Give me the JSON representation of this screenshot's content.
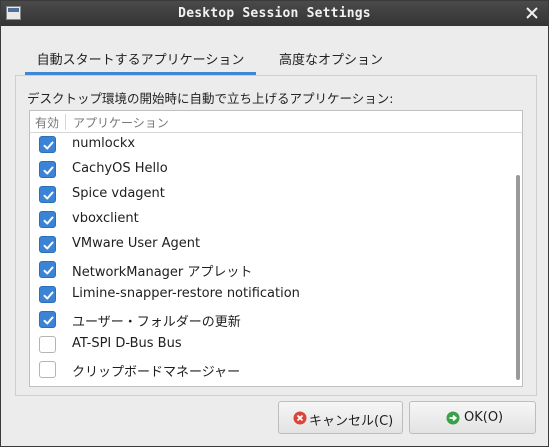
{
  "window": {
    "title": "Desktop Session Settings",
    "icon": "app-window-icon",
    "close_icon": "close-icon"
  },
  "tabs": [
    {
      "label": "自動スタートするアプリケーション",
      "active": true
    },
    {
      "label": "高度なオプション",
      "active": false
    }
  ],
  "description": "デスクトップ環境の開始時に自動で立ち上げるアプリケーション:",
  "list": {
    "columns": {
      "enabled": "有効",
      "application": "アプリケーション"
    },
    "items": [
      {
        "label": "numlockx",
        "checked": true
      },
      {
        "label": "CachyOS Hello",
        "checked": true
      },
      {
        "label": "Spice vdagent",
        "checked": true
      },
      {
        "label": "vboxclient",
        "checked": true
      },
      {
        "label": "VMware User Agent",
        "checked": true
      },
      {
        "label": "NetworkManager アプレット",
        "checked": true
      },
      {
        "label": "Limine-snapper-restore notification",
        "checked": true
      },
      {
        "label": "ユーザー・フォルダーの更新",
        "checked": true
      },
      {
        "label": "AT-SPI D-Bus Bus",
        "checked": false
      },
      {
        "label": "クリップボードマネージャー",
        "checked": false
      }
    ]
  },
  "buttons": {
    "cancel": {
      "label": "キャンセル(C)",
      "icon": "cancel-icon",
      "icon_color": "#d9463b"
    },
    "ok": {
      "label": "OK(O)",
      "icon": "ok-icon",
      "icon_color": "#3aa14a"
    }
  },
  "colors": {
    "accent": "#3b83d6",
    "titlebar": "#3a3a3a"
  }
}
